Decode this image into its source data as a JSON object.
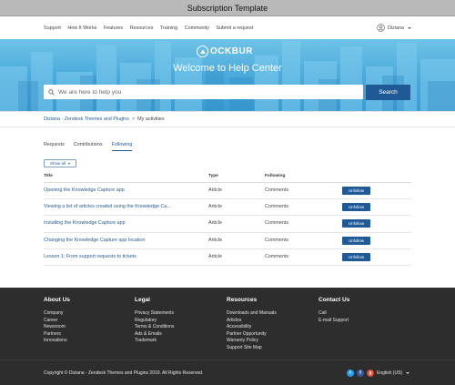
{
  "window": {
    "title": "Subscription Template"
  },
  "nav": {
    "items": [
      "Support",
      "How It Works",
      "Features",
      "Resources",
      "Training",
      "Community",
      "Submit a request"
    ],
    "user_name": "Diziana"
  },
  "hero": {
    "logo_text": "OCKBUR",
    "title": "Welcome to Help Center",
    "search_placeholder": "We are here to help you",
    "search_button": "Search"
  },
  "breadcrumb": [
    "Diziana - Zendesk Themes and Plugins",
    "My activities"
  ],
  "tabs": [
    {
      "label": "Requests",
      "active": false
    },
    {
      "label": "Contributions",
      "active": false
    },
    {
      "label": "Following",
      "active": true
    }
  ],
  "filter": {
    "label": "Show all"
  },
  "table": {
    "headers": [
      "Title",
      "Type",
      "Following"
    ],
    "rows": [
      {
        "title": "Opening the Knowledge Capture app",
        "type": "Article",
        "following": "Comments",
        "action": "Unfollow"
      },
      {
        "title": "Viewing a list of articles created using the Knowledge Ca...",
        "type": "Article",
        "following": "Comments",
        "action": "Unfollow"
      },
      {
        "title": "Installing the Knowledge Capture app",
        "type": "Article",
        "following": "Comments",
        "action": "Unfollow"
      },
      {
        "title": "Changing the Knowledge Capture app location",
        "type": "Article",
        "following": "Comments",
        "action": "Unfollow"
      },
      {
        "title": "Lesson 1: From support requests to tickets",
        "type": "Article",
        "following": "Comments",
        "action": "Unfollow"
      }
    ]
  },
  "footer": {
    "columns": [
      {
        "title": "About Us",
        "links": [
          "Company",
          "Career",
          "Newsroom",
          "Partners",
          "Innovations"
        ]
      },
      {
        "title": "Legal",
        "links": [
          "Privacy Statements",
          "Regulatory",
          "Terms & Conditions",
          "Ads & Emails",
          "Trademark"
        ]
      },
      {
        "title": "Resources",
        "links": [
          "Downloads and Manuals",
          "Articles",
          "Accessibility",
          "Partner Opportunity",
          "Warranty Policy",
          "Support Site Map"
        ]
      },
      {
        "title": "Contact Us",
        "links": [
          "Call",
          "E-mail Support"
        ]
      }
    ],
    "copyright": "Copyright © Diziana - Zendesk Themes and Plugins 2019. All Rights Reserved.",
    "social": [
      {
        "icon": "twitter-icon",
        "glyph": "t",
        "color": "#1da1f2"
      },
      {
        "icon": "facebook-icon",
        "glyph": "f",
        "color": "#3b5998"
      },
      {
        "icon": "google-plus-icon",
        "glyph": "g",
        "color": "#dd4b39"
      }
    ],
    "language": "English (US)"
  },
  "colors": {
    "primary": "#1f5a97",
    "footer_bg": "#2d2d2d",
    "hero": "#48a8da"
  }
}
